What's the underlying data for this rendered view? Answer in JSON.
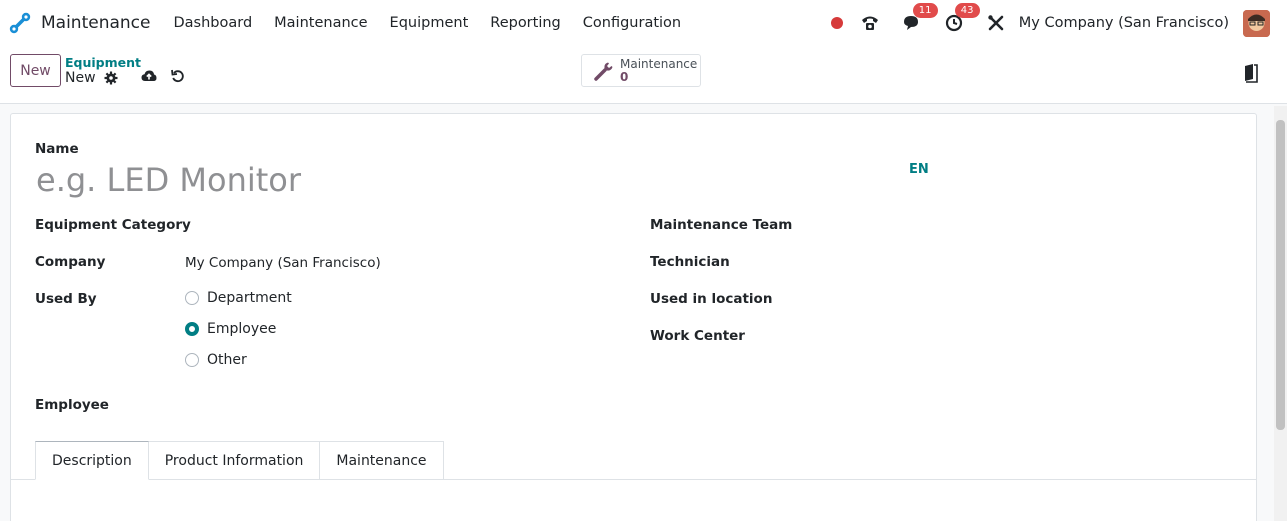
{
  "navbar": {
    "app_title": "Maintenance",
    "menu": [
      "Dashboard",
      "Maintenance",
      "Equipment",
      "Reporting",
      "Configuration"
    ],
    "messages_badge": "11",
    "activities_badge": "43",
    "company": "My Company (San Francisco)"
  },
  "control": {
    "new_label": "New",
    "breadcrumb_parent": "Equipment",
    "breadcrumb_current": "New",
    "smart_button": {
      "label": "Maintenance",
      "value": "0"
    }
  },
  "form": {
    "name_label": "Name",
    "name_placeholder": "e.g. LED Monitor",
    "lang": "EN",
    "equipment_category_label": "Equipment Category",
    "company_label": "Company",
    "company_value": "My Company (San Francisco)",
    "used_by_label": "Used By",
    "used_by_options": [
      "Department",
      "Employee",
      "Other"
    ],
    "used_by_selected": "Employee",
    "employee_label": "Employee",
    "maintenance_team_label": "Maintenance Team",
    "technician_label": "Technician",
    "used_in_location_label": "Used in location",
    "work_center_label": "Work Center"
  },
  "tabs": [
    "Description",
    "Product Information",
    "Maintenance"
  ],
  "colors": {
    "primary": "#714b67",
    "accent": "#017e84",
    "badge": "#e14b4b"
  }
}
